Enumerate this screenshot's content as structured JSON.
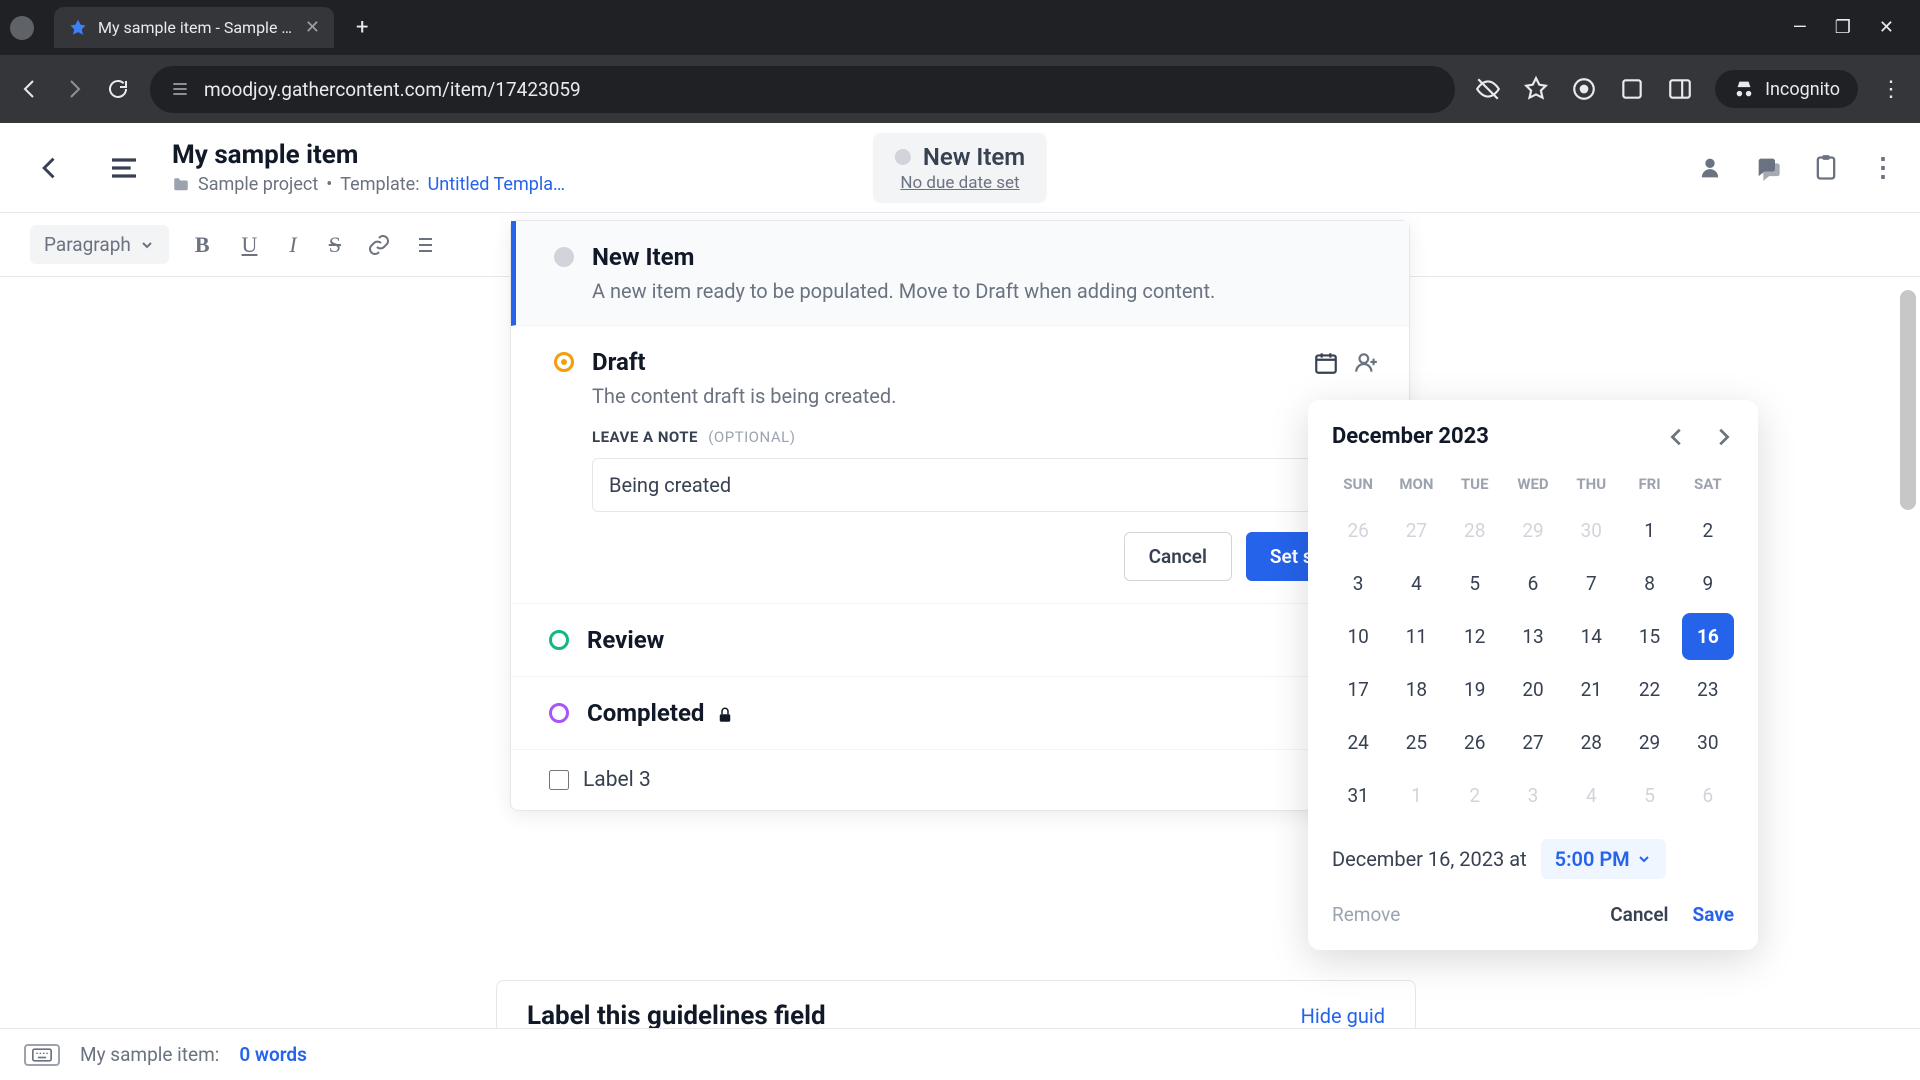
{
  "browser": {
    "tab_title": "My sample item - Sample proj…",
    "url": "moodjoy.gathercontent.com/item/17423059",
    "incognito_label": "Incognito"
  },
  "header": {
    "title": "My sample item",
    "project": "Sample project",
    "separator": "•",
    "template_label": "Template:",
    "template_name": "Untitled Templa…",
    "status_name": "New Item",
    "due_date": "No due date set"
  },
  "toolbar": {
    "paragraph": "Paragraph"
  },
  "workflow": {
    "items": [
      {
        "name": "New Item",
        "desc": "A new item ready to be populated. Move to Draft when adding content."
      },
      {
        "name": "Draft",
        "desc": "The content draft is being created."
      },
      {
        "name": "Review"
      },
      {
        "name": "Completed"
      }
    ],
    "note_label": "LEAVE A NOTE",
    "note_optional": "(OPTIONAL)",
    "note_value": "Being created",
    "cancel": "Cancel",
    "set_status": "Set st",
    "label3": "Label 3"
  },
  "guidelines": {
    "title": "Label this guidelines field",
    "hide": "Hide guid"
  },
  "datepicker": {
    "month": "December 2023",
    "dow": [
      "SUN",
      "MON",
      "TUE",
      "WED",
      "THU",
      "FRI",
      "SAT"
    ],
    "weeks": [
      [
        {
          "d": "26",
          "m": true
        },
        {
          "d": "27",
          "m": true
        },
        {
          "d": "28",
          "m": true
        },
        {
          "d": "29",
          "m": true
        },
        {
          "d": "30",
          "m": true
        },
        {
          "d": "1"
        },
        {
          "d": "2"
        }
      ],
      [
        {
          "d": "3"
        },
        {
          "d": "4"
        },
        {
          "d": "5"
        },
        {
          "d": "6"
        },
        {
          "d": "7"
        },
        {
          "d": "8"
        },
        {
          "d": "9"
        }
      ],
      [
        {
          "d": "10"
        },
        {
          "d": "11"
        },
        {
          "d": "12"
        },
        {
          "d": "13"
        },
        {
          "d": "14"
        },
        {
          "d": "15"
        },
        {
          "d": "16",
          "sel": true
        }
      ],
      [
        {
          "d": "17"
        },
        {
          "d": "18"
        },
        {
          "d": "19"
        },
        {
          "d": "20"
        },
        {
          "d": "21"
        },
        {
          "d": "22"
        },
        {
          "d": "23"
        }
      ],
      [
        {
          "d": "24"
        },
        {
          "d": "25"
        },
        {
          "d": "26"
        },
        {
          "d": "27"
        },
        {
          "d": "28"
        },
        {
          "d": "29"
        },
        {
          "d": "30"
        }
      ],
      [
        {
          "d": "31"
        },
        {
          "d": "1",
          "m": true
        },
        {
          "d": "2",
          "m": true
        },
        {
          "d": "3",
          "m": true
        },
        {
          "d": "4",
          "m": true
        },
        {
          "d": "5",
          "m": true
        },
        {
          "d": "6",
          "m": true
        }
      ]
    ],
    "selected_date": "December 16, 2023 at",
    "time": "5:00 PM",
    "remove": "Remove",
    "cancel": "Cancel",
    "save": "Save"
  },
  "footer": {
    "label": "My sample item:",
    "words": "0 words"
  }
}
